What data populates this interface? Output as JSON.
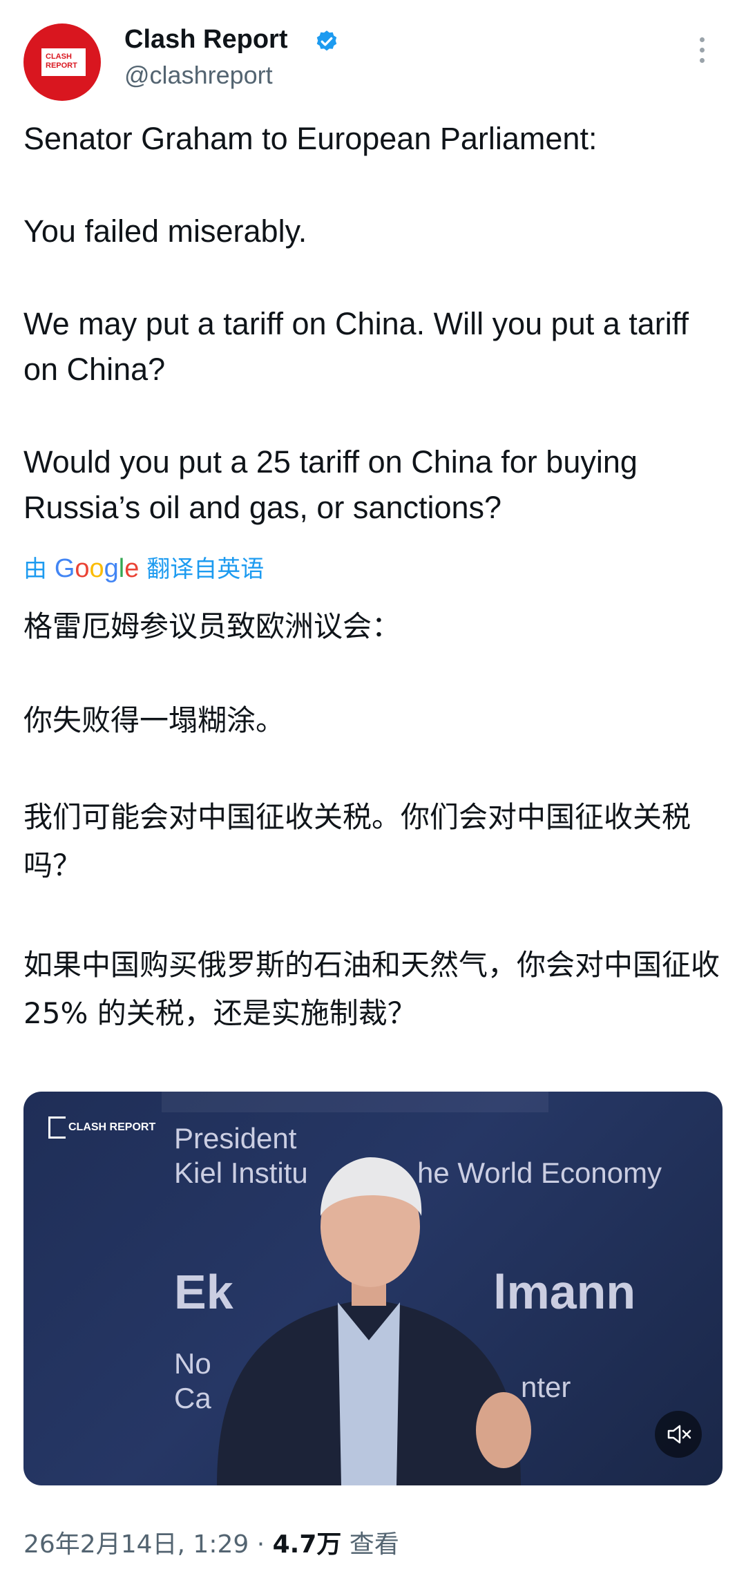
{
  "account": {
    "avatar_text": "CLASH REPORT",
    "name": "Clash Report",
    "handle": "@clashreport",
    "verified": true
  },
  "tweet": {
    "en": [
      "Senator Graham to European Parliament:",
      "You failed miserably.",
      "We may put a tariff on China. Will you put a tariff on China?",
      "Would you put a 25 tariff on China for buying Russia’s oil and gas, or sanctions?"
    ],
    "translate_prefix": "由",
    "translate_brand": "Google",
    "translate_suffix": "翻译自英语",
    "zh": [
      "格雷厄姆参议员致欧洲议会：",
      "你失败得一塌糊涂。",
      "我们可能会对中国征收关税。你们会对中国征收关税吗？",
      "如果中国购买俄罗斯的石油和天然气，你会对中国征收 25% 的关税，还是实施制裁？"
    ]
  },
  "video": {
    "watermark": "CLASH REPORT",
    "stage_line1": "President",
    "stage_line2": "Kiel Institu",
    "stage_line3": "he World Economy",
    "stage_name_left": "Ek",
    "stage_name_right": "lmann",
    "stage_small_left1": "No",
    "stage_small_left2": "Ca",
    "stage_small_right": "nter"
  },
  "footer": {
    "date": "26年2月14日, 1:29 · ",
    "views": "4.7万",
    "views_label": " 查看"
  },
  "colors": {
    "accent": "#1d9bf0",
    "brand_red": "#d9161f"
  }
}
